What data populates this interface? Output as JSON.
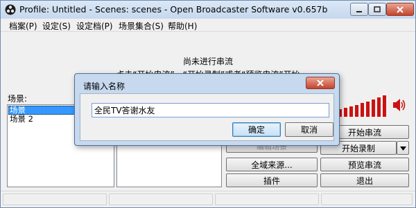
{
  "window": {
    "title": "Profile: Untitled - Scenes: scenes - Open Broadcaster Software v0.657b"
  },
  "menu": [
    "档案(P)",
    "设定(S)",
    "设定档(P)",
    "场景集合(S)",
    "帮助(H)"
  ],
  "status": {
    "line1": "尚未进行串流",
    "line2": "点击“开始串流”、“开始录制”或者“预览串流”开始"
  },
  "scenes": {
    "label": "场景:",
    "items": [
      "场景",
      "场景 2"
    ]
  },
  "buttons": {
    "settings_partial": "编辑场景",
    "global_sources": "全域来源...",
    "plugins": "插件",
    "start_stream": "开始串流",
    "start_record": "开始录制",
    "preview_stream": "预览串流",
    "exit": "退出"
  },
  "volume": {
    "level_fraction": 0.9,
    "color": "#cc1111"
  },
  "dialog": {
    "title": "请输入名称",
    "input_value": "全民TV答谢水友",
    "ok": "确定",
    "cancel": "取消"
  }
}
